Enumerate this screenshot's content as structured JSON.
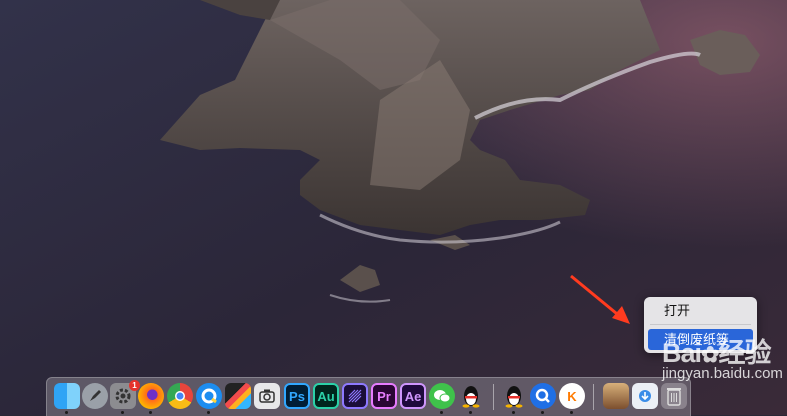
{
  "context_menu": {
    "open_label": "打开",
    "empty_trash_label": "清倒废纸篓"
  },
  "watermark": {
    "logo_text": "Bai",
    "logo_text_2": "经验",
    "url": "jingyan.baidu.com"
  },
  "dock": {
    "items": [
      {
        "name": "Finder",
        "icon": "finder-icon",
        "label": ""
      },
      {
        "name": "Launchpad",
        "icon": "rocket-icon",
        "label": ""
      },
      {
        "name": "System Preferences",
        "icon": "gear-icon",
        "label": "",
        "badge": "1"
      },
      {
        "name": "Firefox",
        "icon": "firefox-icon",
        "label": ""
      },
      {
        "name": "Chrome",
        "icon": "chrome-icon",
        "label": ""
      },
      {
        "name": "QQ Browser",
        "icon": "qq-browser-icon",
        "label": ""
      },
      {
        "name": "Final Cut Pro",
        "icon": "clapperboard-icon",
        "label": ""
      },
      {
        "name": "Screenshot",
        "icon": "camera-icon",
        "label": ""
      },
      {
        "name": "Photoshop",
        "icon": "photoshop-icon",
        "label": "Ps"
      },
      {
        "name": "Audition",
        "icon": "audition-icon",
        "label": "Au"
      },
      {
        "name": "Media Encoder",
        "icon": "media-encoder-icon",
        "label": ""
      },
      {
        "name": "Premiere Pro",
        "icon": "premiere-icon",
        "label": "Pr"
      },
      {
        "name": "After Effects",
        "icon": "after-effects-icon",
        "label": "Ae"
      },
      {
        "name": "WeChat",
        "icon": "wechat-icon",
        "label": ""
      },
      {
        "name": "QQ",
        "icon": "penguin-icon",
        "label": ""
      },
      {
        "name": "QQ 2",
        "icon": "penguin-icon",
        "label": ""
      },
      {
        "name": "Q Search",
        "icon": "q-search-icon",
        "label": ""
      },
      {
        "name": "Kuaishou",
        "icon": "k-icon",
        "label": "K"
      },
      {
        "name": "Preview",
        "icon": "photo-icon",
        "label": ""
      },
      {
        "name": "Downloads",
        "icon": "downloads-icon",
        "label": ""
      },
      {
        "name": "Trash",
        "icon": "trash-icon",
        "label": ""
      }
    ]
  },
  "colors": {
    "menu_highlight": "#2a66d9",
    "arrow": "#ff3b1f"
  }
}
